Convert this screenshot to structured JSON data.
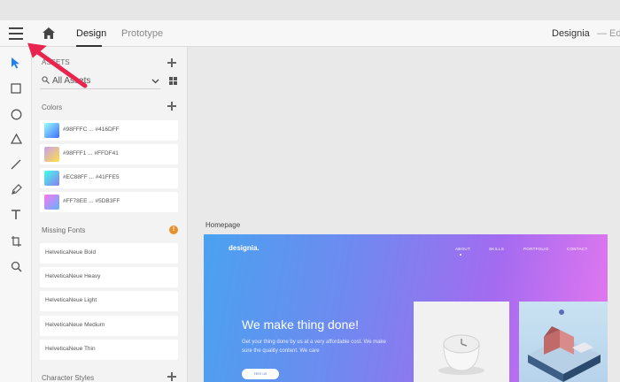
{
  "header": {
    "tabs": [
      {
        "label": "Design",
        "active": true
      },
      {
        "label": "Prototype",
        "active": false
      }
    ],
    "doc_title": "Designia",
    "doc_status": "— Edited"
  },
  "toolbar": {
    "tools": [
      "select-arrow-icon",
      "rectangle-icon",
      "ellipse-icon",
      "triangle-icon",
      "line-icon",
      "pen-icon",
      "text-icon",
      "artboard-icon",
      "zoom-icon"
    ]
  },
  "assets": {
    "section_label": "ASSETS",
    "search_placeholder": "All Assets",
    "colors_label": "Colors",
    "colors": [
      {
        "label": "#98FFFC ... #416DFF",
        "from": "#98FFFC",
        "to": "#416DFF"
      },
      {
        "label": "#98FFF1 ... #FFDF41",
        "from": "#C7A0F0",
        "to": "#FFDF41"
      },
      {
        "label": "#EC88FF ... #41FFE5",
        "from": "#41FFE5",
        "to": "#8A7CF4"
      },
      {
        "label": "#FF78EE ... #5DB3FF",
        "from": "#FF78EE",
        "to": "#5DB3FF"
      }
    ],
    "missing_fonts_label": "Missing Fonts",
    "warning_glyph": "!",
    "fonts": [
      "HelveticaNeue Bold",
      "HelveticaNeue Heavy",
      "HelveticaNeue Light",
      "HelveticaNeue Medium",
      "HelveticaNeue Thin"
    ],
    "character_styles_label": "Character Styles"
  },
  "canvas": {
    "artboard_label": "Homepage",
    "brand": "designia.",
    "nav": [
      "ABOUT",
      "SKILLS",
      "PORTFOLIO",
      "CONTACT"
    ],
    "hero_title": "We make thing done!",
    "hero_subtitle": "Get your thing done by us at a very affordable cost. We make sure the quality content. We care",
    "hero_button": "Hire us"
  },
  "colors": {
    "accent_arrow": "#E8244F",
    "selected_tool": "#2680EB"
  }
}
